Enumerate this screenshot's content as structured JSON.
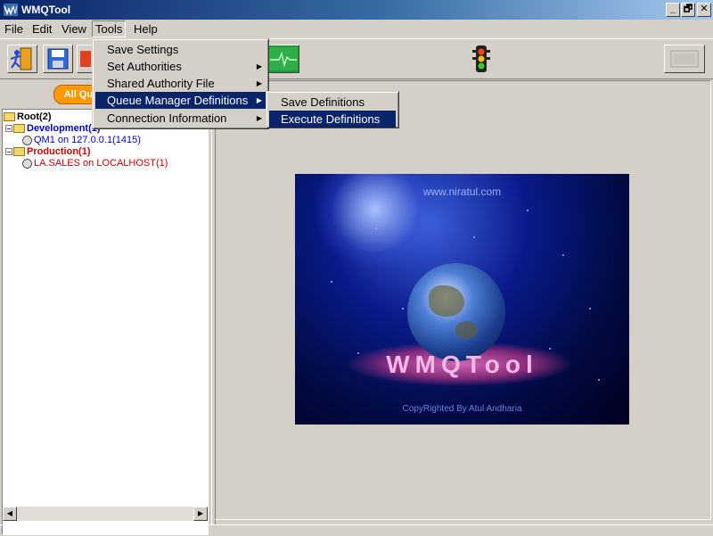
{
  "window": {
    "title": "WMQTool",
    "minimize": "_",
    "restore": "🗗",
    "close": "✕"
  },
  "menubar": [
    "File",
    "Edit",
    "View",
    "Tools",
    "Help"
  ],
  "tools_menu": {
    "items": [
      {
        "label": "Save Settings",
        "submenu": false
      },
      {
        "label": "Set Authorities",
        "submenu": true
      },
      {
        "label": "Shared Authority File",
        "submenu": true
      },
      {
        "label": "Queue Manager Definitions",
        "submenu": true,
        "highlighted": true
      },
      {
        "label": "Connection Information",
        "submenu": true
      }
    ]
  },
  "qm_definitions_submenu": {
    "items": [
      {
        "label": "Save Definitions"
      },
      {
        "label": "Execute Definitions",
        "highlighted": true
      }
    ]
  },
  "left_panel": {
    "tab_label": "All Que",
    "tree": {
      "root": "Root(2)",
      "groups": [
        {
          "label": "Development(1)",
          "color": "#0000cc",
          "children": [
            "QM1 on 127.0.0.1(1415)"
          ]
        },
        {
          "label": "Production(1)",
          "color": "#cc0000",
          "children": [
            "LA.SALES on LOCALHOST(1)"
          ]
        }
      ]
    }
  },
  "splash": {
    "url": "www.niratul.com",
    "logo": "WMQTool",
    "copyright": "CopyRighted By Atul Andharia"
  },
  "colors": {
    "menu_highlight": "#0a246a",
    "orange_tab": "#ff9900"
  }
}
